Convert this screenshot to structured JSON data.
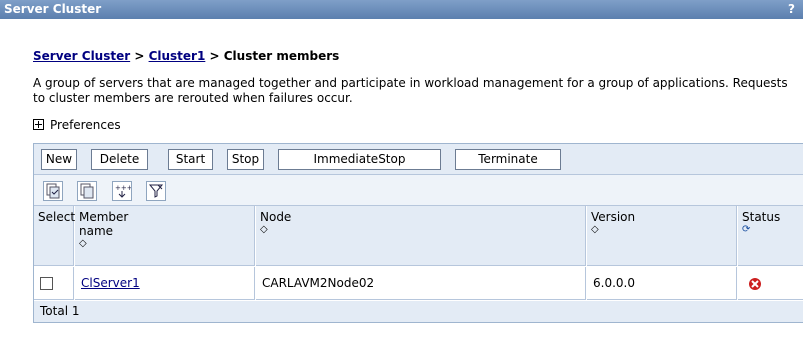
{
  "window": {
    "title": "Server Cluster",
    "help": "?"
  },
  "breadcrumb": {
    "link1": "Server Cluster",
    "sep1": " > ",
    "link2": "Cluster1",
    "sep2": " > ",
    "current": "Cluster members"
  },
  "description": "A group of servers that are managed together and participate in workload management for a group of applications. Requests to cluster members are rerouted when failures occur.",
  "preferences": {
    "label": "Preferences"
  },
  "toolbar": {
    "new": "New",
    "delete": "Delete",
    "start": "Start",
    "stop": "Stop",
    "immediate_stop": "ImmediateStop",
    "terminate": "Terminate"
  },
  "icons": [
    "select-all-icon",
    "deselect-all-icon",
    "show-filter-icon",
    "clear-filter-icon"
  ],
  "table": {
    "headers": {
      "select": "Select",
      "member_name": "Member name",
      "node": "Node",
      "version": "Version",
      "status": "Status"
    },
    "rows": [
      {
        "member_name": "ClServer1",
        "node": "CARLAVM2Node02",
        "version": "6.0.0.0",
        "status": "stopped"
      }
    ],
    "total": "Total 1"
  },
  "colors": {
    "title_bar": "#5b7fae",
    "toolbar_bg": "#e3ebf5",
    "link": "#000080",
    "status_stopped": "#cc1f1f"
  }
}
